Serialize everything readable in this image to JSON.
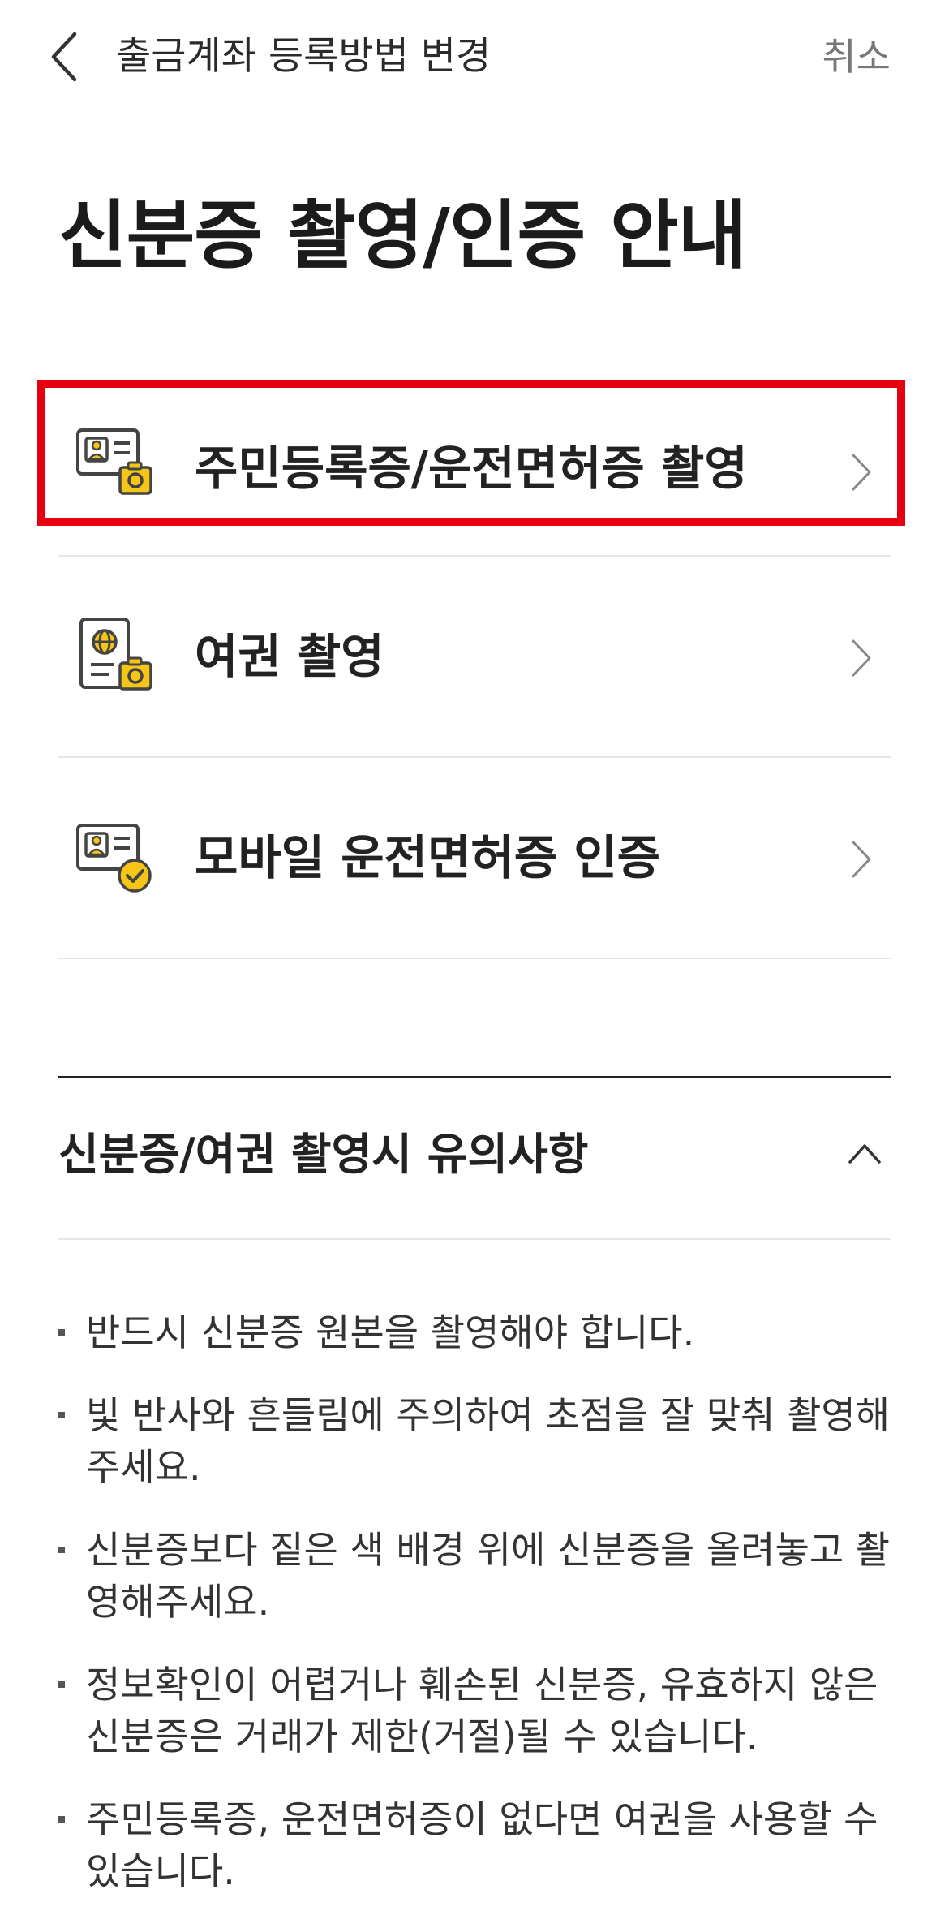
{
  "header": {
    "title": "출금계좌 등록방법 변경",
    "cancel_label": "취소",
    "back_icon": "chevron-left-icon"
  },
  "page": {
    "title": "신분증 촬영/인증 안내"
  },
  "options": [
    {
      "label": "주민등록증/운전면허증 촬영",
      "icon": "id-card-camera-icon",
      "highlighted": true
    },
    {
      "label": "여권 촬영",
      "icon": "passport-camera-icon",
      "highlighted": false
    },
    {
      "label": "모바일 운전면허증 인증",
      "icon": "id-card-check-icon",
      "highlighted": false
    }
  ],
  "notice": {
    "title": "신분증/여권 촬영시 유의사항",
    "expanded": true,
    "items": [
      "반드시 신분증 원본을 촬영해야 합니다.",
      "빛 반사와 흔들림에 주의하여 초점을 잘 맞춰 촬영해주세요.",
      "신분증보다 짙은 색 배경 위에 신분증을 올려놓고 촬영해주세요.",
      "정보확인이 어렵거나 훼손된 신분증, 유효하지 않은 신분증은 거래가 제한(거절)될 수 있습니다.",
      "주민등록증, 운전면허증이 없다면 여권을 사용할 수 있습니다."
    ]
  },
  "colors": {
    "accent_yellow": "#f5c518",
    "highlight_red": "#e60012",
    "text_primary": "#222222",
    "text_secondary": "#777777"
  }
}
